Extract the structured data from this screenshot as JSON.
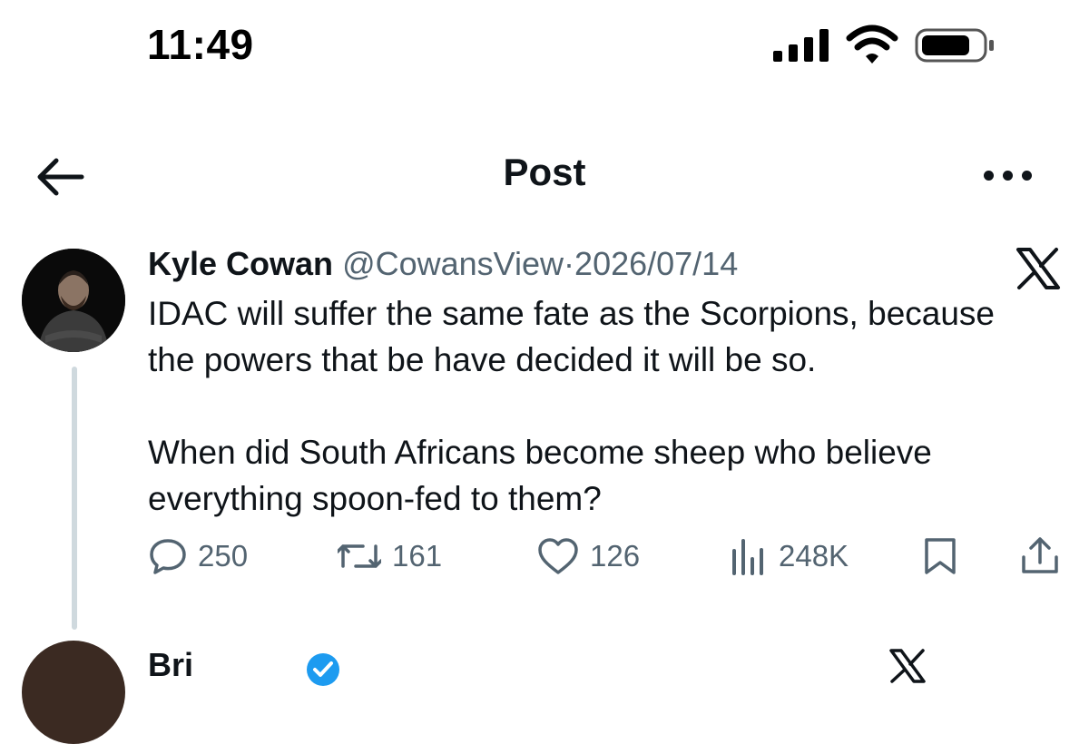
{
  "status_bar": {
    "time": "11:49"
  },
  "header": {
    "title": "Post"
  },
  "post": {
    "author_name": "Kyle Cowan",
    "handle": "@CowansView",
    "separator": "·",
    "date": "2026/07/14",
    "text_lines": [
      "IDAC will suffer the same fate as the Scorpions, because",
      "the powers that be have decided it will be so.",
      "When did South Africans become sheep who believe",
      "everything spoon-fed to them?"
    ],
    "actions": {
      "replies": "250",
      "reposts": "161",
      "likes": "126",
      "views": "248K"
    }
  },
  "next_post": {
    "author_name_partial": "Bri"
  },
  "icons": {
    "back": "arrow-left-icon",
    "more": "ellipsis-icon",
    "platform": "x-logo-icon",
    "reply": "speech-bubble-icon",
    "repost": "repost-arrows-icon",
    "like": "heart-icon",
    "views": "bar-chart-icon",
    "bookmark": "bookmark-icon",
    "share": "share-upload-icon"
  },
  "colors": {
    "text": "#0f1419",
    "secondary": "#536471",
    "thread_line": "#cfd9de",
    "verified": "#1d9bf0"
  }
}
